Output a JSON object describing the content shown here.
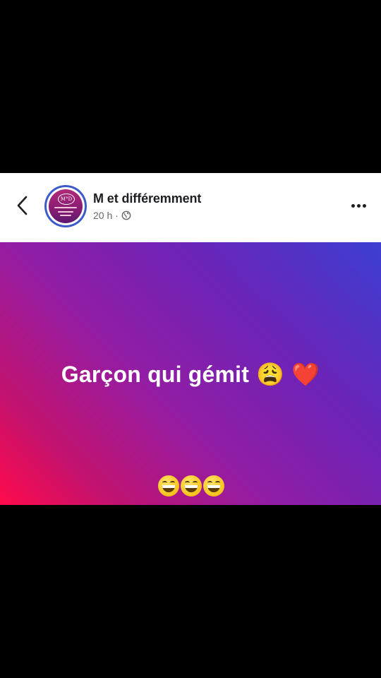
{
  "post": {
    "author": "M et différemment",
    "time": "20 h",
    "separator": "·",
    "visibility_icon": "globe-icon",
    "text": "Garçon qui gémit",
    "text_emojis": [
      "😩",
      "❤️"
    ],
    "reaction_emojis": [
      "😄",
      "😄",
      "😄"
    ],
    "back_icon": "chevron-left-icon",
    "more_icon": "more-horizontal-icon"
  },
  "colors": {
    "gradient_top_right": "#3c3fd2",
    "gradient_middle": "#921da4",
    "gradient_bottom_left": "#ff0a4a",
    "avatar_ring": "#3c5ac8"
  }
}
